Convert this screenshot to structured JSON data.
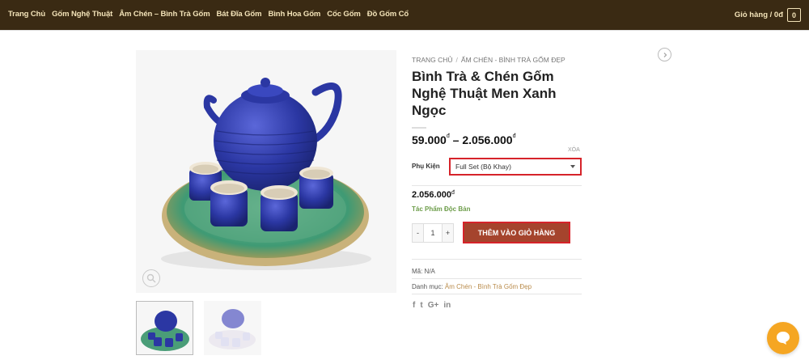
{
  "nav": {
    "items": [
      "Trang Chủ",
      "Gốm Nghệ Thuật",
      "Âm Chén – Bình Trà Gốm",
      "Bát Đĩa Gốm",
      "Bình Hoa Gốm",
      "Cốc Gốm",
      "Đồ Gốm Cổ"
    ],
    "cart_label": "Giỏ hàng / 0đ",
    "cart_count": "0"
  },
  "breadcrumb": {
    "home": "TRANG CHỦ",
    "separator": "/",
    "category": "ẤM CHÉN - BÌNH TRÀ GỐM ĐẸP"
  },
  "product": {
    "title": "Bình Trà & Chén Gốm Nghệ Thuật Men Xanh Ngọc",
    "price_min": "59.000",
    "price_max": "2.056.000",
    "currency": "đ",
    "price_sep": "–",
    "clear_label": "XÓA",
    "attr_label": "Phụ Kiện",
    "attr_selected": "Full Set (Bộ Khay)",
    "variation_price": "2.056.000",
    "stock": "Tác Phẩm Độc Bản",
    "qty_minus": "-",
    "qty_value": "1",
    "qty_plus": "+",
    "add_to_cart": "THÊM VÀO GIỎ HÀNG",
    "sku": "Mã: N/A",
    "category_label": "Danh mục:",
    "category_link": "Âm Chén - Bình Trà Gốm Đẹp"
  },
  "share_icons": [
    "facebook-icon",
    "twitter-icon",
    "google-plus-icon",
    "linkedin-icon"
  ],
  "share_glyphs": {
    "facebook": "f",
    "twitter": "t",
    "gplus": "G+",
    "linkedin": "in"
  },
  "colors": {
    "header_bg": "#3a2a13",
    "nav_text": "#f3e3b8",
    "accent_red": "#d6232a",
    "button_bg": "#a5442d",
    "chat": "#f5a623",
    "stock_green": "#6d9d4a",
    "link": "#b98b4b"
  }
}
